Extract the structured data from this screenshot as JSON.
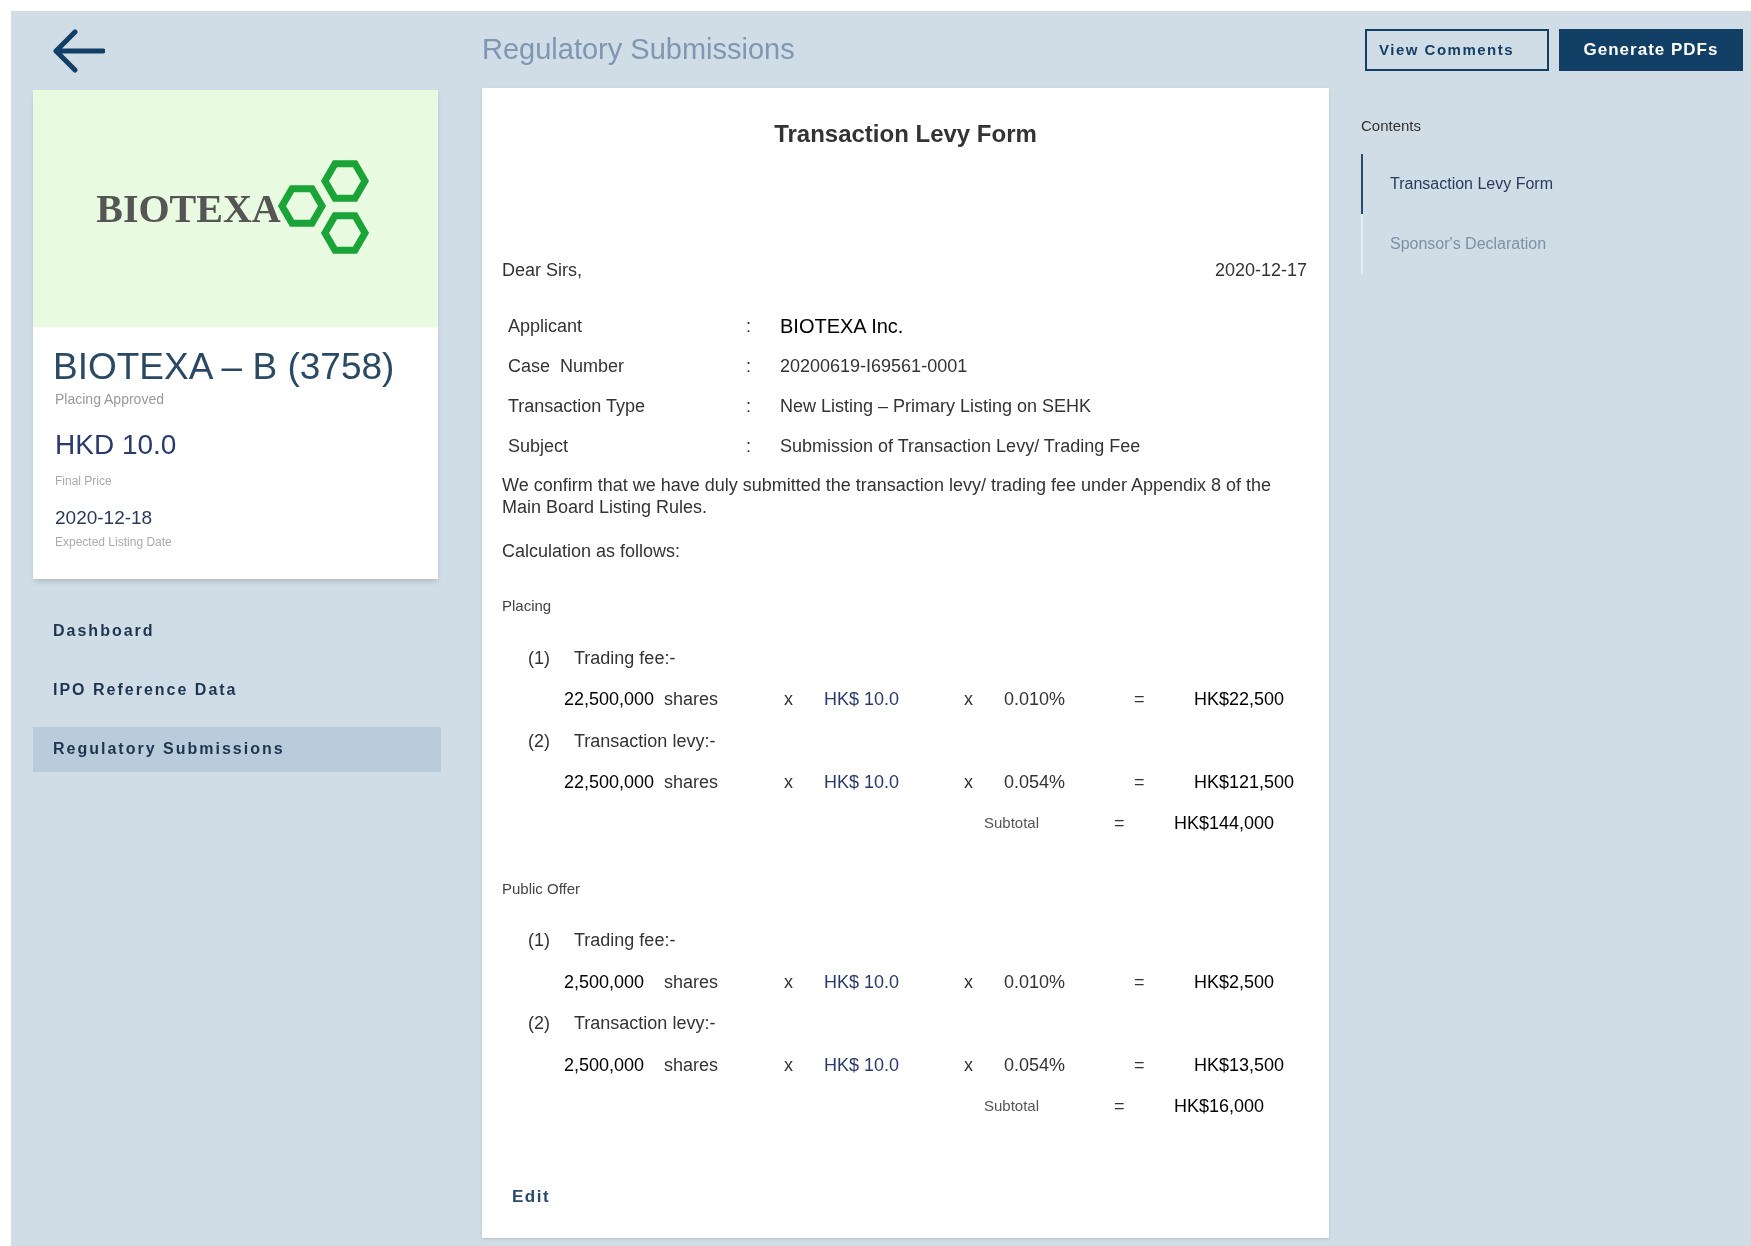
{
  "header": {
    "title": "Regulatory Submissions",
    "buttons": [
      {
        "label": "View Comments",
        "kind": "outline"
      },
      {
        "label": "Generate PDFs",
        "kind": "primary"
      }
    ]
  },
  "company_card": {
    "logo_text": "BIOTEXA",
    "name": "BIOTEXA – B (3758)",
    "status": "Placing Approved",
    "price": "HKD 10.0",
    "price_label": "Final Price",
    "listing_date": "2020-12-18",
    "listing_date_label": "Expected Listing Date"
  },
  "sidebar": {
    "items": [
      {
        "label": "Dashboard",
        "selected": false
      },
      {
        "label": "IPO Reference Data",
        "selected": false
      },
      {
        "label": "Regulatory Submissions",
        "selected": true
      }
    ]
  },
  "document": {
    "title": "Transaction Levy Form",
    "salutation": "Dear Sirs,",
    "date": "2020-12-17",
    "fields": [
      {
        "label": "Applicant",
        "separator": ":",
        "value": "BIOTEXA Inc."
      },
      {
        "label": "Case  Number",
        "separator": ":",
        "value": "20200619-I69561-0001"
      },
      {
        "label": "Transaction Type",
        "separator": ":",
        "value": "New Listing – Primary Listing on SEHK"
      },
      {
        "label": "Subject",
        "separator": ":",
        "value": "Submission of Transaction Levy/ Trading Fee"
      }
    ],
    "paragraph": "We confirm that we have duly submitted the transaction levy/ trading fee under Appendix 8 of the Main Board Listing Rules.",
    "calculation_intro": "Calculation as follows:",
    "sections": [
      {
        "title": "Placing",
        "items": [
          {
            "number": "(1)",
            "label": "Trading fee:-",
            "shares": "22,500,000",
            "unit": "shares",
            "times_1": "x",
            "price": "HK$ 10.0",
            "times_2": "x",
            "rate": "0.010%",
            "equals": "=",
            "amount": "HK$22,500"
          },
          {
            "number": "(2)",
            "label": "Transaction levy:-",
            "shares": "22,500,000",
            "unit": "shares",
            "times_1": "x",
            "price": "HK$ 10.0",
            "times_2": "x",
            "rate": "0.054%",
            "equals": "=",
            "amount": "HK$121,500"
          }
        ],
        "subtotal": {
          "label": "Subtotal",
          "equals": "=",
          "amount": "HK$144,000"
        }
      },
      {
        "title": "Public Offer",
        "items": [
          {
            "number": "(1)",
            "label": "Trading fee:-",
            "shares": "2,500,000",
            "unit": "shares",
            "times_1": "x",
            "price": "HK$ 10.0",
            "times_2": "x",
            "rate": "0.010%",
            "equals": "=",
            "amount": "HK$2,500"
          },
          {
            "number": "(2)",
            "label": "Transaction levy:-",
            "shares": "2,500,000",
            "unit": "shares",
            "times_1": "x",
            "price": "HK$ 10.0",
            "times_2": "x",
            "rate": "0.054%",
            "equals": "=",
            "amount": "HK$13,500"
          }
        ],
        "subtotal": {
          "label": "Subtotal",
          "equals": "=",
          "amount": "HK$16,000"
        }
      }
    ],
    "edit_link": "Edit"
  },
  "contents": {
    "title": "Contents",
    "items": [
      {
        "label": "Transaction Levy Form",
        "selected": true
      },
      {
        "label": "Sponsor's Declaration",
        "selected": false
      }
    ]
  }
}
